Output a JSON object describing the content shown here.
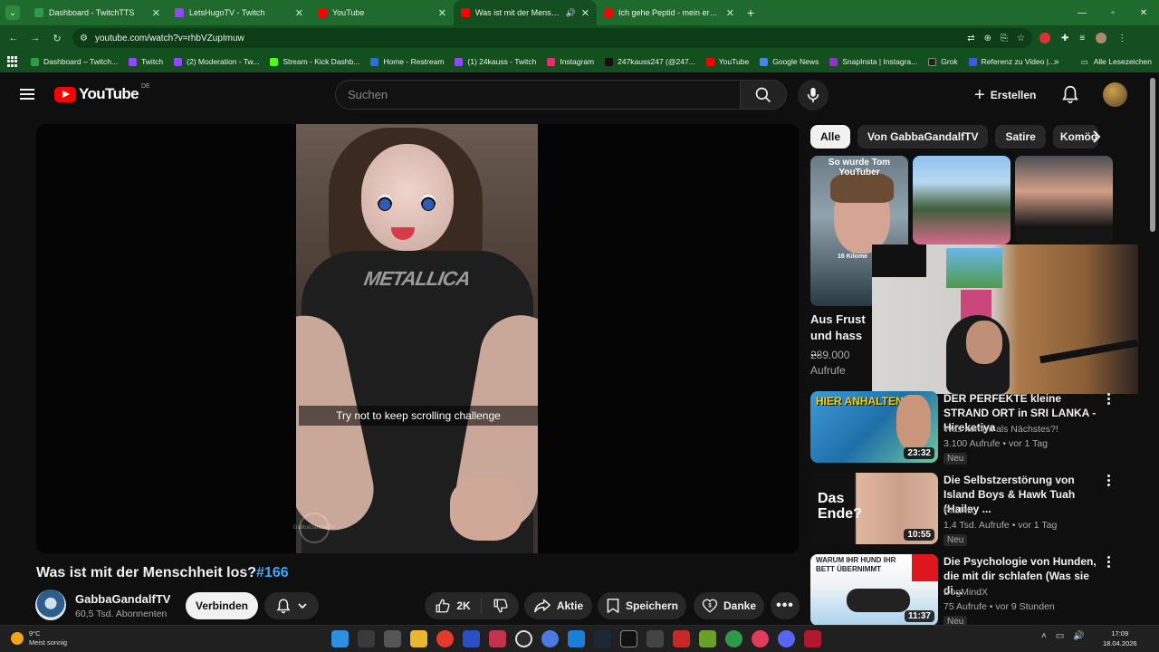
{
  "browser": {
    "tabs": [
      {
        "label": "Dashboard - TwitchTTS",
        "color": "#2e9a4a",
        "active": false
      },
      {
        "label": "LetsHugoTV - Twitch",
        "color": "#9146ff",
        "active": false
      },
      {
        "label": "YouTube",
        "color": "#ff0000",
        "active": false
      },
      {
        "label": "Was ist mit der Menschheit",
        "color": "#ff0000",
        "active": true
      },
      {
        "label": "Ich gehe Peptid - mein erster P...",
        "color": "#ff0000",
        "active": false
      }
    ],
    "url": "youtube.com/watch?v=rhbVZupImuw",
    "bookmarks": [
      {
        "label": "Dashboard – Twitch...",
        "color": "#2e9a4a"
      },
      {
        "label": "Twitch",
        "color": "#9146ff"
      },
      {
        "label": "(2) Moderation - Tw...",
        "color": "#9146ff"
      },
      {
        "label": "Stream - Kick Dashb...",
        "color": "#53fc18"
      },
      {
        "label": "Home - Restream",
        "color": "#2a6fdb"
      },
      {
        "label": "(1) 24kauss - Twitch",
        "color": "#9146ff"
      },
      {
        "label": "Instagram",
        "color": "#e1306c"
      },
      {
        "label": "247kauss247 (@247...",
        "color": "#111111"
      },
      {
        "label": "YouTube",
        "color": "#ff0000"
      },
      {
        "label": "Google News",
        "color": "#4285f4"
      },
      {
        "label": "SnapInsta | Instagra...",
        "color": "#8a3ab9"
      },
      {
        "label": "Grok",
        "color": "#222222"
      },
      {
        "label": "Referenz zu Video |...",
        "color": "#3b5bdb"
      }
    ],
    "all_bookmarks": "Alle Lesezeichen"
  },
  "youtube": {
    "logo_text": "YouTube",
    "country": "DE",
    "search_placeholder": "Suchen",
    "create_label": "Erstellen"
  },
  "video": {
    "caption": "Try not to keep scrolling challenge",
    "shirt_text": "METALLICA",
    "watermark": "GabbaGandalfTV",
    "title": "Was ist mit der Menschheit los?",
    "hashtag": "#166",
    "channel": "GabbaGandalfTV",
    "subscribers": "60,5 Tsd. Abonnenten",
    "join_label": "Verbinden",
    "likes": "2K",
    "share_label": "Aktie",
    "save_label": "Speichern",
    "thanks_label": "Danke"
  },
  "chips": [
    "Alle",
    "Von GabbaGandalfTV",
    "Satire",
    "Komöd"
  ],
  "shorts": {
    "card_text": "So wurde Tom YouTuber",
    "card_tag": "16 Kilome",
    "title": "Aus Frust und hass ...",
    "views": "289.000 Aufrufe"
  },
  "recommendations": [
    {
      "title": "DER PERFEKTE kleine STRAND ORT in SRI LANKA - Hireketiya",
      "channel": "Was kommt als Nächstes?!",
      "meta": "3.100 Aufrufe • vor 1 Tag",
      "badge": "Neu",
      "duration": "23:32",
      "thumb_text": "HIER ANHALTEN!"
    },
    {
      "title": "Die Selbstzerstörung von Island Boys & Hawk Tuah (Hailey ...",
      "channel": "PhilFlix",
      "meta": "1,4 Tsd. Aufrufe • vor 1 Tag",
      "badge": "Neu",
      "duration": "10:55",
      "thumb_text": "Das Ende?"
    },
    {
      "title": "Die Psychologie von Hunden, die mit dir schlafen (Was sie di...",
      "channel": "DogMindX",
      "meta": "75 Aufrufe • vor 9 Stunden",
      "badge": "Neu",
      "duration": "11:37",
      "thumb_text": "WARUM IHR HUND IHR BETT ÜBERNIMMT"
    }
  ],
  "taskbar": {
    "temperature": "9°C",
    "weather": "Meist sonnig",
    "time": "17:09",
    "date": "18.04.2026"
  }
}
